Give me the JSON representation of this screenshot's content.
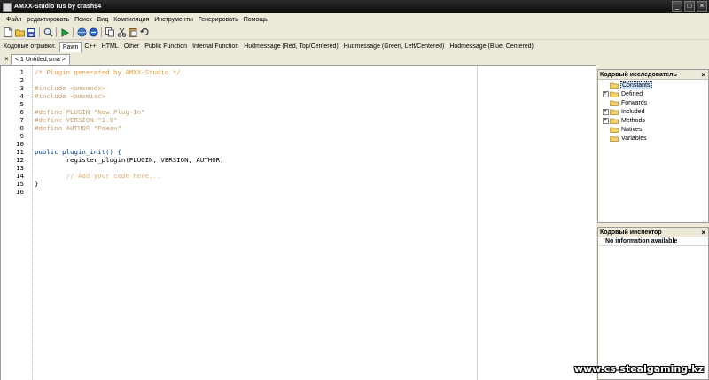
{
  "window": {
    "title": "AMXX-Studio rus by crash94"
  },
  "menubar": {
    "items": [
      "Файл",
      "редактировать",
      "Поиск",
      "Вид",
      "Компиляция",
      "Инструменты",
      "Генерировать",
      "Помощь"
    ]
  },
  "toolbar": {
    "icons": [
      "new-file-icon",
      "open-folder-icon",
      "save-icon",
      "search-icon",
      "compile-run-icon",
      "globe-icon",
      "web-icon",
      "copy-icon",
      "cut-icon",
      "paste-icon",
      "undo-icon"
    ]
  },
  "snippets": {
    "label": "Кодовые отрывки:",
    "tabs": [
      "Pawn",
      "C++",
      "HTML",
      "Other",
      "Public Function",
      "Internal Function",
      "Hudmessage (Red, Top/Centered)",
      "Hudmessage (Green, Left/Centered)",
      "Hudmessage (Blue, Centered)"
    ],
    "active": "Pawn"
  },
  "document": {
    "tab_label": "< 1 Untitled.sma >"
  },
  "editor": {
    "line_numbers": [
      "1",
      "2",
      "3",
      "4",
      "5",
      "6",
      "7",
      "8",
      "9",
      "10",
      "11",
      "12",
      "13",
      "14",
      "15",
      "16"
    ],
    "lines": [
      "/* Plugin generated by AMXX-Studio */",
      "",
      "#include <amxmodx>",
      "#include <amxmisc>",
      "",
      "#define PLUGIN \"New Plug-In\"",
      "#define VERSION \"1.0\"",
      "#define AUTHOR \"Рожан\"",
      "",
      "",
      "public plugin_init() {",
      "        register_plugin(PLUGIN, VERSION, AUTHOR)",
      "",
      "        // Add your code here...",
      "}",
      ""
    ]
  },
  "explorer": {
    "title": "Кодовый исследователь",
    "items": [
      {
        "label": "Constants",
        "expandable": false,
        "selected": true
      },
      {
        "label": "Defined",
        "expandable": true,
        "selected": false
      },
      {
        "label": "Forwards",
        "expandable": false,
        "selected": false
      },
      {
        "label": "Included",
        "expandable": true,
        "selected": false
      },
      {
        "label": "Methods",
        "expandable": true,
        "selected": false
      },
      {
        "label": "Natives",
        "expandable": false,
        "selected": false
      },
      {
        "label": "Variables",
        "expandable": false,
        "selected": false
      }
    ]
  },
  "inspector": {
    "title": "Кодовый инспектор",
    "message": "No information available"
  },
  "watermark": "www.cs-stealgaming.kz",
  "colors": {
    "comment": "#e8a040",
    "preprocessor": "#c8a070",
    "keyword": "#003a8c",
    "titlebar": "#1a1a1a",
    "chrome": "#ece9d8"
  }
}
